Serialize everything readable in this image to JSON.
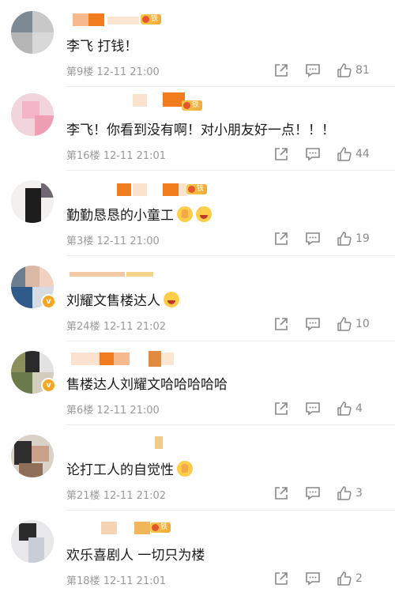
{
  "comments": [
    {
      "text": "李飞 打钱！",
      "floor": "第9楼",
      "time": "12-11 21:00",
      "likes": "81",
      "badge": "铁粉"
    },
    {
      "text": "李飞！你看到没有啊！对小朋友好一点！！！",
      "floor": "第16楼",
      "time": "12-11 21:01",
      "likes": "44",
      "badge": "铁粉"
    },
    {
      "text": "勤勤恳恳的小童工",
      "floor": "第3楼",
      "time": "12-11 21:00",
      "likes": "19",
      "badge": "铁粉"
    },
    {
      "text": "刘耀文售楼达人",
      "floor": "第24楼",
      "time": "12-11 21:02",
      "likes": "10",
      "badge": ""
    },
    {
      "text": "售楼达人刘耀文哈哈哈哈哈",
      "floor": "第6楼",
      "time": "12-11 21:00",
      "likes": "4",
      "badge": ""
    },
    {
      "text": "论打工人的自觉性",
      "floor": "第21楼",
      "time": "12-11 21:02",
      "likes": "3",
      "badge": ""
    },
    {
      "text": "欢乐喜剧人 一切只为楼",
      "floor": "第18楼",
      "time": "12-11 21:01",
      "likes": "2",
      "badge": "铁粉"
    }
  ],
  "colors": {
    "accent": "#f0a93a",
    "meta_text": "#9a9a9a",
    "divider": "#ececec"
  },
  "icons": {
    "share": "share-icon",
    "reply": "comment-icon",
    "like": "thumbs-up-icon"
  }
}
